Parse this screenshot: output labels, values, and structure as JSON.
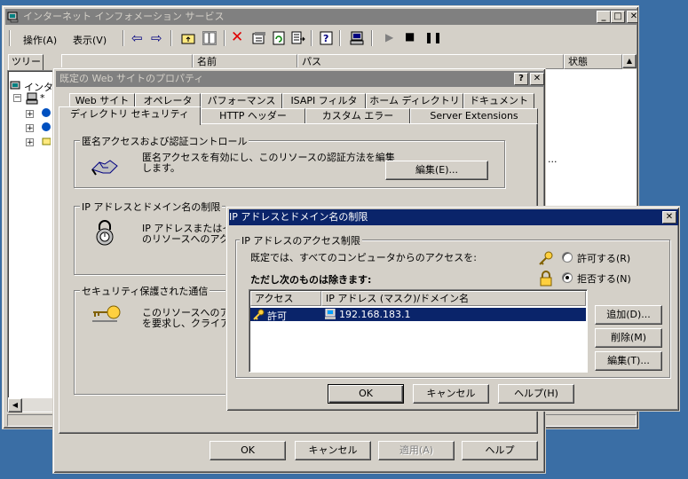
{
  "mmc": {
    "title": "インターネット インフォメーション サービス",
    "menu": {
      "action": "操作(A)",
      "view": "表示(V)"
    },
    "tree_tab": "ツリー",
    "tree_root": "インタ",
    "tree_machine": "*",
    "columns": {
      "name": "名前",
      "path": "パス",
      "status": "状態"
    },
    "status_cell": "..."
  },
  "props": {
    "title": "既定の Web サイトのプロパティ",
    "tabs_row1": [
      "Web サイト",
      "オペレータ",
      "パフォーマンス",
      "ISAPI フィルタ",
      "ホーム ディレクトリ",
      "ドキュメント"
    ],
    "tabs_row2": [
      "ディレクトリ セキュリティ",
      "HTTP ヘッダー",
      "カスタム エラー",
      "Server Extensions"
    ],
    "anon": {
      "group": "匿名アクセスおよび認証コントロール",
      "desc1": "匿名アクセスを有効にし、このリソースの認証方法を編集",
      "desc2": "します。",
      "edit": "編集(E)..."
    },
    "ip": {
      "group": "IP アドレスとドメイン名の制限",
      "desc1": "IP アドレスまたはイ",
      "desc2": "のリソースへのアク"
    },
    "secure": {
      "group": "セキュリティ保護された通信",
      "desc1": "このリソースへのア",
      "desc2": "を要求し、クライア"
    },
    "buttons": {
      "ok": "OK",
      "cancel": "キャンセル",
      "apply": "適用(A)",
      "help": "ヘルプ"
    }
  },
  "ipdlg": {
    "title": "IP アドレスとドメイン名の制限",
    "group": "IP アドレスのアクセス制限",
    "default_text": "既定では、すべてのコンピュータからのアクセスを:",
    "radio_allow": "許可する(R)",
    "radio_deny": "拒否する(N)",
    "selected": "deny",
    "except_label": "ただし次のものは除きます:",
    "columns": {
      "access": "アクセス",
      "ip": "IP アドレス (マスク)/ドメイン名"
    },
    "rows": [
      {
        "access": "許可",
        "ip": "192.168.183.1"
      }
    ],
    "side_buttons": {
      "add": "追加(D)...",
      "remove": "削除(M)",
      "edit": "編集(T)..."
    },
    "buttons": {
      "ok": "OK",
      "cancel": "キャンセル",
      "help": "ヘルプ(H)"
    }
  },
  "colors": {
    "desktop": "#3a6ea5",
    "active_title": "#0a246a",
    "inactive_title": "#808080",
    "face": "#d4d0c8"
  }
}
